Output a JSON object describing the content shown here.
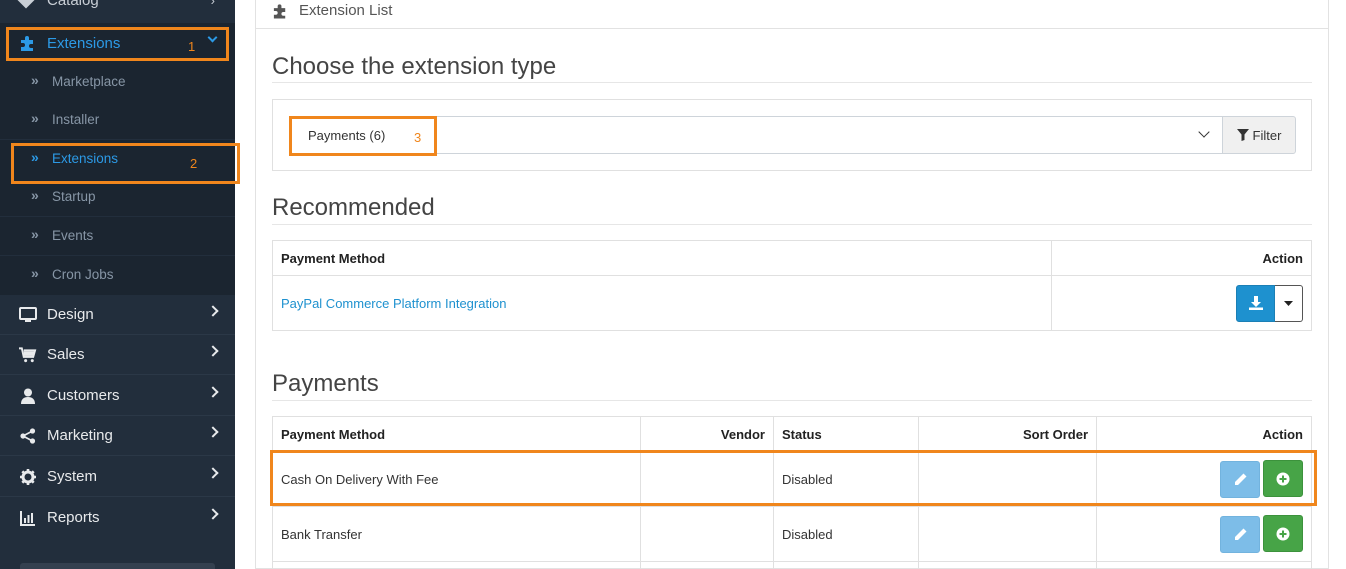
{
  "sidebar": {
    "partial_item": "Catalog",
    "extensions": "Extensions",
    "sub_items": [
      {
        "label": "Marketplace"
      },
      {
        "label": "Installer"
      },
      {
        "label": "Extensions"
      },
      {
        "label": "Startup"
      },
      {
        "label": "Events"
      },
      {
        "label": "Cron Jobs"
      }
    ],
    "items": [
      {
        "label": "Design",
        "icon": "monitor-icon"
      },
      {
        "label": "Sales",
        "icon": "cart-icon"
      },
      {
        "label": "Customers",
        "icon": "user-icon"
      },
      {
        "label": "Marketing",
        "icon": "share-icon"
      },
      {
        "label": "System",
        "icon": "gear-icon"
      },
      {
        "label": "Reports",
        "icon": "bar-chart-icon"
      }
    ],
    "sub_glyph": "»"
  },
  "panel": {
    "title": "Extension List"
  },
  "choose": {
    "title": "Choose the extension type",
    "selected": "Payments (6)",
    "filter_label": "Filter"
  },
  "recommended": {
    "title": "Recommended",
    "headers": {
      "method": "Payment Method",
      "action": "Action"
    },
    "rows": [
      {
        "method": "PayPal Commerce Platform Integration"
      }
    ]
  },
  "payments": {
    "title": "Payments",
    "headers": {
      "method": "Payment Method",
      "vendor": "Vendor",
      "status": "Status",
      "sort_order": "Sort Order",
      "action": "Action"
    },
    "rows": [
      {
        "method": "Cash On Delivery With Fee",
        "vendor": "",
        "status": "Disabled",
        "sort_order": ""
      },
      {
        "method": "Bank Transfer",
        "vendor": "",
        "status": "Disabled",
        "sort_order": ""
      }
    ]
  },
  "annotations": [
    "1",
    "2",
    "3"
  ],
  "colors": {
    "sidebar_bg": "#222e3c",
    "active": "#2c9ae6",
    "annotation": "#f0861c",
    "link": "#1e91cf",
    "success": "#47a447"
  }
}
